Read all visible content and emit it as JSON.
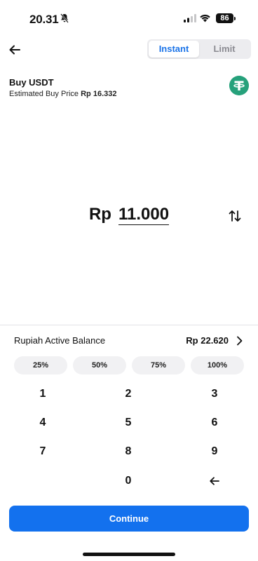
{
  "status": {
    "time": "20.31",
    "battery": "86"
  },
  "header": {
    "tabs": [
      "Instant",
      "Limit"
    ]
  },
  "asset": {
    "title": "Buy USDT",
    "price_label": "Estimated Buy Price",
    "price_value": "Rp 16.332",
    "token_icon": "tether-icon",
    "token_color": "#26a17b"
  },
  "amount": {
    "prefix": "Rp",
    "value": "11.000"
  },
  "balance": {
    "label": "Rupiah Active Balance",
    "value": "Rp 22.620"
  },
  "percent_options": [
    "25%",
    "50%",
    "75%",
    "100%"
  ],
  "keypad": [
    "1",
    "2",
    "3",
    "4",
    "5",
    "6",
    "7",
    "8",
    "9",
    "0"
  ],
  "continue_label": "Continue",
  "colors": {
    "accent": "#1371ee",
    "tab_active": "#1a73e8"
  }
}
